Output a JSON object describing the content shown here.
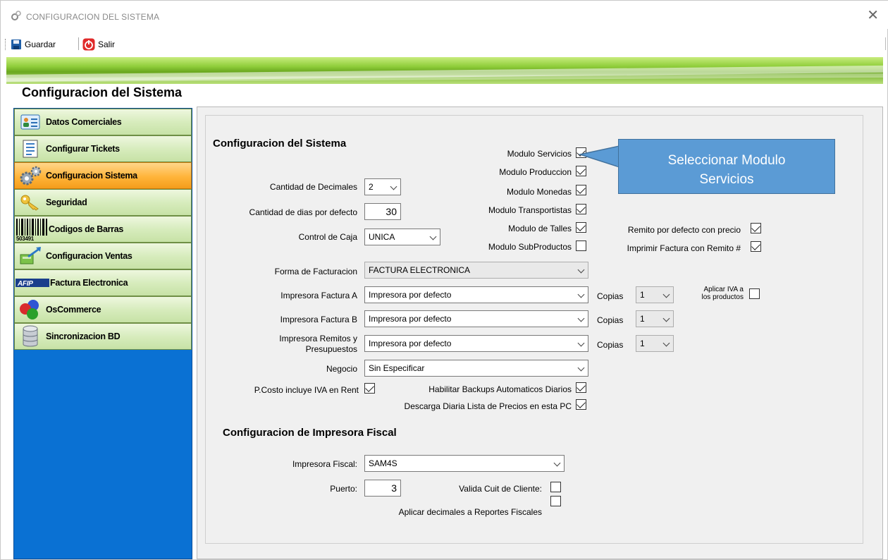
{
  "window": {
    "title": "CONFIGURACION DEL SISTEMA",
    "close_glyph": "✕"
  },
  "toolbar": {
    "save_label": "Guardar",
    "exit_label": "Salir"
  },
  "page_title": "Configuracion del Sistema",
  "sidebar": {
    "items": [
      {
        "label": "Datos Comerciales",
        "icon": "contact-card-icon"
      },
      {
        "label": "Configurar Tickets",
        "icon": "document-list-icon"
      },
      {
        "label": "Configuracion Sistema",
        "icon": "gears-icon",
        "active": true
      },
      {
        "label": "Seguridad",
        "icon": "key-icon"
      },
      {
        "label": "Codigos de Barras",
        "icon": "barcode-icon",
        "icon_text": "503491"
      },
      {
        "label": "Configuracion Ventas",
        "icon": "sales-arrow-icon"
      },
      {
        "label": "Factura Electronica",
        "icon": "afip-logo-icon",
        "icon_text": "AFIP"
      },
      {
        "label": "OsCommerce",
        "icon": "colored-balls-icon"
      },
      {
        "label": "Sincronizacion BD",
        "icon": "database-icon"
      }
    ]
  },
  "system": {
    "heading": "Configuracion del Sistema",
    "decimals_label": "Cantidad de Decimales",
    "decimals_value": "2",
    "days_label": "Cantidad de dias por defecto",
    "days_value": "30",
    "cash_label": "Control de Caja",
    "cash_value": "UNICA",
    "modules": [
      {
        "label": "Modulo Servicios",
        "checked": true
      },
      {
        "label": "Modulo Produccion",
        "checked": true
      },
      {
        "label": "Modulo Monedas",
        "checked": true
      },
      {
        "label": "Modulo Transportistas",
        "checked": true
      },
      {
        "label": "Modulo de Talles",
        "checked": true
      },
      {
        "label": "Modulo SubProductos",
        "checked": false
      }
    ],
    "remito_price_label": "Remito por defecto con precio",
    "remito_price_checked": true,
    "print_invoice_label": "Imprimir Factura con Remito #",
    "print_invoice_checked": true,
    "billing_label": "Forma de Facturacion",
    "billing_value": "FACTURA ELECTRONICA",
    "printer_a_label": "Impresora Factura A",
    "printer_a_value": "Impresora por defecto",
    "printer_b_label": "Impresora Factura B",
    "printer_b_value": "Impresora por defecto",
    "printer_r_label_1": "Impresora Remitos y",
    "printer_r_label_2": "Presupuestos",
    "printer_r_value": "Impresora por defecto",
    "copies_label": "Copias",
    "copies_a": "1",
    "copies_b": "1",
    "copies_r": "1",
    "iva_label_1": "Aplicar IVA a",
    "iva_label_2": "los productos",
    "iva_checked": false,
    "business_label": "Negocio",
    "business_value": "Sin Especificar",
    "cost_iva_label": "P.Costo incluye IVA en Rent",
    "cost_iva_checked": true,
    "backups_label": "Habilitar Backups Automaticos Diarios",
    "backups_checked": true,
    "download_label": "Descarga Diaria Lista de Precios en esta PC",
    "download_checked": true
  },
  "fiscal": {
    "heading": "Configuracion de Impresora Fiscal",
    "printer_label": "Impresora Fiscal:",
    "printer_value": "SAM4S",
    "port_label": "Puerto:",
    "port_value": "3",
    "cuit_label": "Valida Cuit de Cliente:",
    "cuit_checked": false,
    "decimals_label": "Aplicar decimales a Reportes Fiscales",
    "decimals_checked": false
  },
  "callout": {
    "line1": "Seleccionar Modulo",
    "line2": "Servicios"
  },
  "colors": {
    "sidebar_bg": "#0a71d3",
    "active_item": "#ffb43a",
    "callout": "#5b9bd5",
    "banner": "#8fcd3a"
  }
}
